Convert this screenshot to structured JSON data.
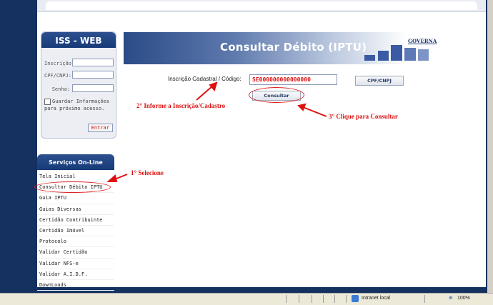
{
  "login": {
    "title": "ISS - WEB",
    "inscricao_label": "Inscrição:",
    "cpf_label": "CPF/CNPJ:",
    "senha_label": "Senha:",
    "guardar_label": "Guardar Informações para próximo acesso.",
    "enter_label": "Entrar"
  },
  "services": {
    "title": "Serviços On-Line",
    "items": [
      "Tela Inicial",
      "Consultar Débito IPTU",
      "Guia IPTU",
      "Guias Diversas",
      "Certidão Contribuinte",
      "Certidão Imóvel",
      "Protocolo",
      "Validar Certidão",
      "Validar NFS-e",
      "Validar A.I.D.F.",
      "DownLoads"
    ]
  },
  "banner": {
    "title": "Consultar Débito (IPTU)",
    "logo": "GOVERNA"
  },
  "form": {
    "label": "Inscrição Cadastral / Código:",
    "value": "SE000000000000000",
    "cpf_button": "CPF/CNPJ",
    "consultar_button": "Consultar"
  },
  "annotations": {
    "step1": "1°  Selecione",
    "step2": "2° Informe a Inscrição/Cadastro",
    "step3": "3° Clique para Consultar"
  },
  "status": {
    "zone": "Intranet local",
    "zoom": "100%"
  }
}
